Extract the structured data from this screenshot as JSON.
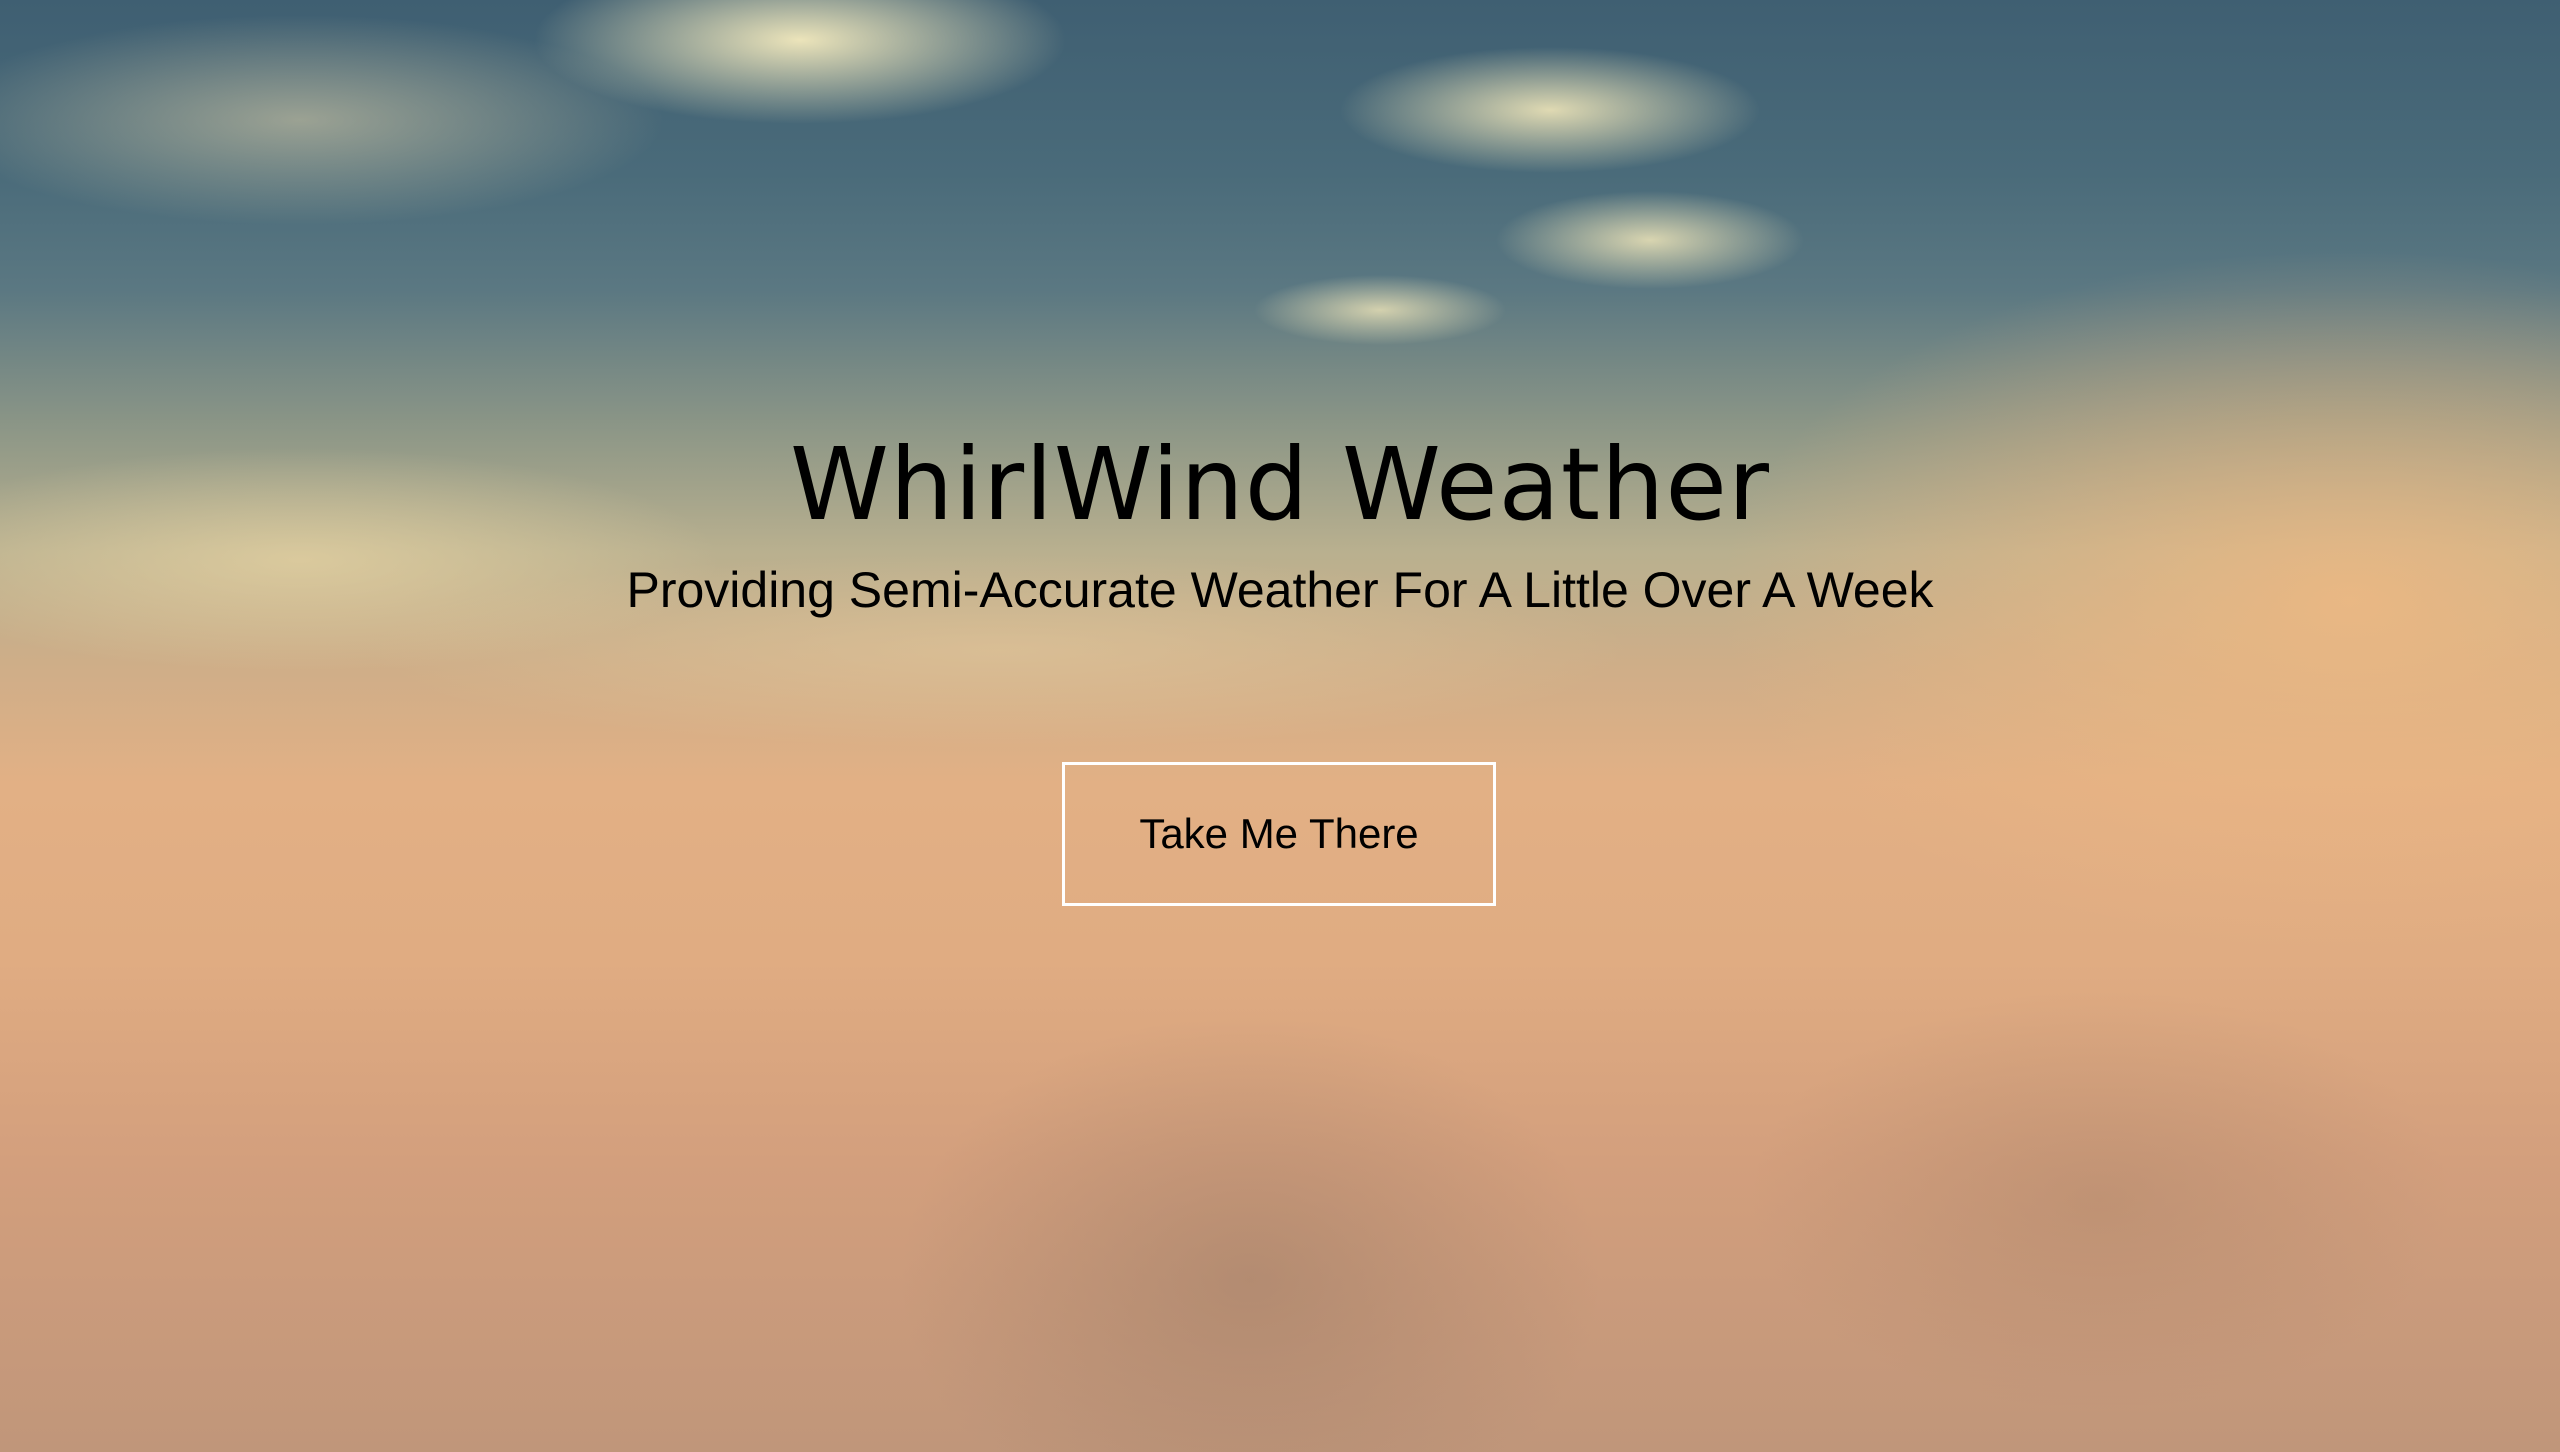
{
  "hero": {
    "title": "WhirlWind Weather",
    "subtitle": "Providing Semi-Accurate Weather For A Little Over A Week",
    "cta_label": "Take Me There"
  },
  "colors": {
    "text": "#000000",
    "button_border": "#ffffff",
    "sky_top": "#3f5f72",
    "cloud_bottom": "#e0ac82"
  }
}
